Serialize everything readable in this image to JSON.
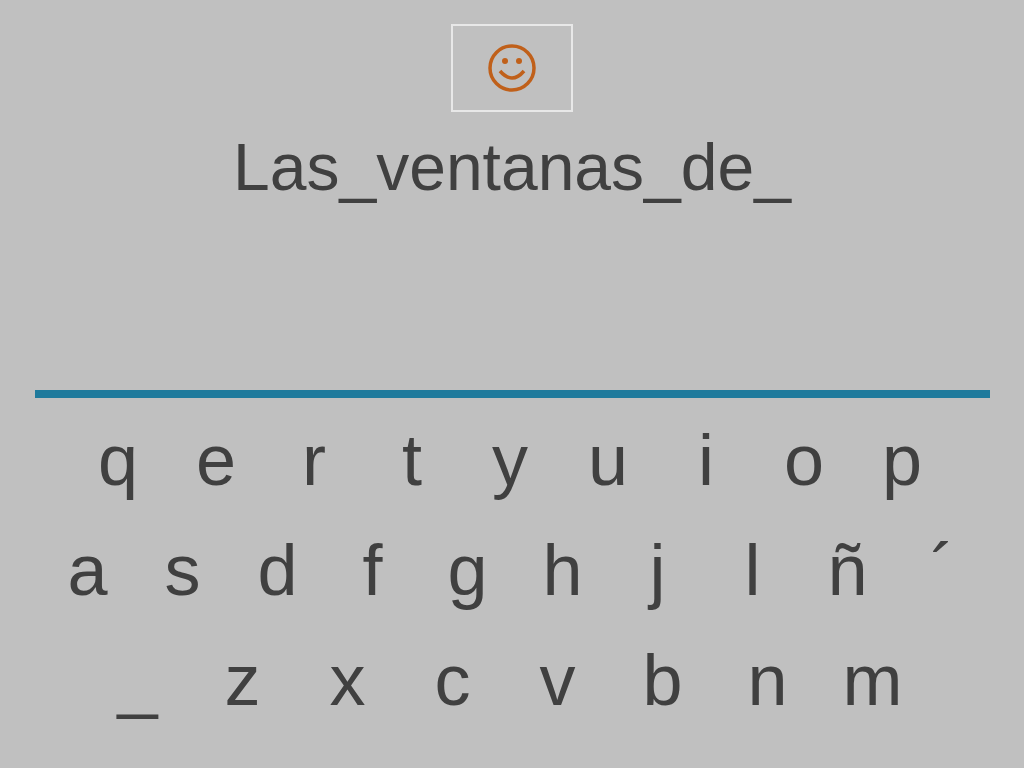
{
  "word": "Las_ventanas_de_",
  "keyboard": [
    [
      "q",
      "e",
      "r",
      "t",
      "y",
      "u",
      "i",
      "o",
      "p"
    ],
    [
      "a",
      "s",
      "d",
      "f",
      "g",
      "h",
      "j",
      "l",
      "ñ",
      "´"
    ],
    [
      "_",
      "z",
      "x",
      "c",
      "v",
      "b",
      "n",
      "m"
    ]
  ]
}
